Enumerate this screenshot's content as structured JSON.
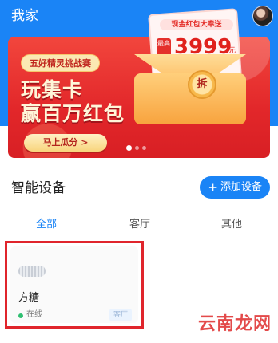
{
  "header": {
    "title": "我家",
    "avatar_icon": "user-avatar"
  },
  "banner": {
    "badge": "五好精灵挑战赛",
    "headline_line1": "玩集卡",
    "headline_line2": "赢百万红包",
    "cta": "马上瓜分 >",
    "ticket_label": "现金红包大奉送",
    "ticket_tag": "最高",
    "amount": "3999",
    "unit": "元",
    "seal": "拆",
    "carousel_dots": 3,
    "carousel_active_index": 0,
    "colors": {
      "banner_red": "#e2272a",
      "gold": "#f8d47c"
    }
  },
  "devices": {
    "title": "智能设备",
    "add_button": "添加设备",
    "add_icon": "plus-icon",
    "tabs": [
      {
        "label": "全部",
        "active": true
      },
      {
        "label": "客厅",
        "active": false
      },
      {
        "label": "其他",
        "active": false
      }
    ],
    "items": [
      {
        "name": "方糖",
        "status": "在线",
        "room": "客厅",
        "status_color": "#2fbf71"
      }
    ]
  },
  "watermark": "云南龙网",
  "colors": {
    "primary": "#1a84f6",
    "highlight_border": "#e0252c"
  }
}
